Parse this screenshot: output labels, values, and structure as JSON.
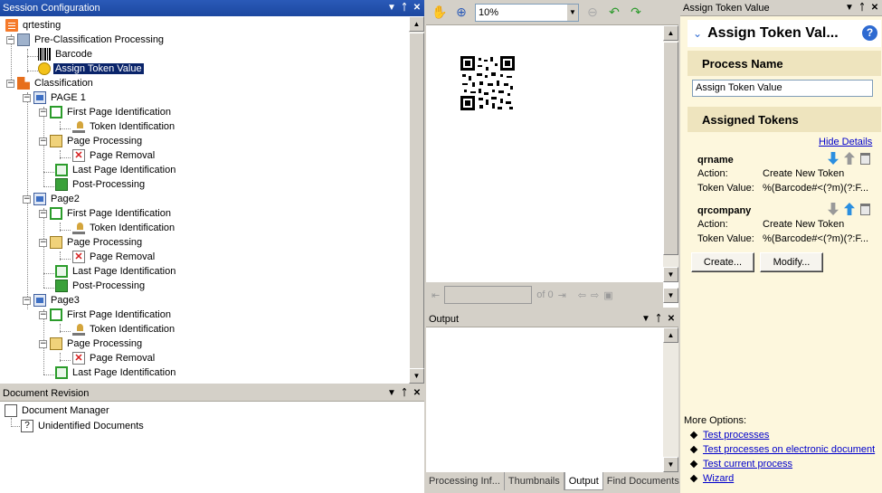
{
  "session_config": {
    "title": "Session Configuration",
    "tree": [
      {
        "label": "qrtesting",
        "icon": "doc-icon"
      },
      {
        "label": "Pre-Classification Processing",
        "icon": "gear-icon"
      },
      {
        "label": "Barcode",
        "icon": "barcode-icon"
      },
      {
        "label": "Assign Token Value",
        "icon": "token-icon"
      },
      {
        "label": "Classification",
        "icon": "classification-icon"
      },
      {
        "label": "PAGE 1",
        "icon": "page-icon"
      },
      {
        "label": "First Page Identification",
        "icon": "identification-icon"
      },
      {
        "label": "Token Identification",
        "icon": "token-identification-icon"
      },
      {
        "label": "Page Processing",
        "icon": "processing-icon"
      },
      {
        "label": "Page Removal",
        "icon": "remove-icon"
      },
      {
        "label": "Last Page Identification",
        "icon": "last-page-icon"
      },
      {
        "label": "Post-Processing",
        "icon": "post-processing-icon"
      },
      {
        "label": "Page2",
        "icon": "page-icon"
      },
      {
        "label": "First Page Identification",
        "icon": "identification-icon"
      },
      {
        "label": "Token Identification",
        "icon": "token-identification-icon"
      },
      {
        "label": "Page Processing",
        "icon": "processing-icon"
      },
      {
        "label": "Page Removal",
        "icon": "remove-icon"
      },
      {
        "label": "Last Page Identification",
        "icon": "last-page-icon"
      },
      {
        "label": "Post-Processing",
        "icon": "post-processing-icon"
      },
      {
        "label": "Page3",
        "icon": "page-icon"
      },
      {
        "label": "First Page Identification",
        "icon": "identification-icon"
      },
      {
        "label": "Token Identification",
        "icon": "token-identification-icon"
      },
      {
        "label": "Page Processing",
        "icon": "processing-icon"
      },
      {
        "label": "Page Removal",
        "icon": "remove-icon"
      },
      {
        "label": "Last Page Identification",
        "icon": "last-page-icon"
      }
    ]
  },
  "doc_revision": {
    "title": "Document Revision",
    "items": [
      {
        "label": "Document Manager",
        "icon": "document-manager-icon"
      },
      {
        "label": "Unidentified Documents",
        "icon": "unidentified-icon"
      }
    ]
  },
  "viewer": {
    "zoom": "10%",
    "page_of": "of 0"
  },
  "output": {
    "title": "Output"
  },
  "tabs": [
    "Processing Inf...",
    "Thumbnails",
    "Output",
    "Find Documents"
  ],
  "assign_panel": {
    "pane_title": "Assign Token Value",
    "heading": "Assign Token Val...",
    "process_name_label": "Process Name",
    "process_name_value": "Assign Token Value",
    "assigned_tokens_label": "Assigned Tokens",
    "hide_details": "Hide Details",
    "tokens": [
      {
        "name": "qrname",
        "action_label": "Action:",
        "action": "Create New Token",
        "value_label": "Token Value:",
        "value": "%(Barcode#<(?m)(?:F..."
      },
      {
        "name": "qrcompany",
        "action_label": "Action:",
        "action": "Create New Token",
        "value_label": "Token Value:",
        "value": "%(Barcode#<(?m)(?:F..."
      }
    ],
    "create_button": "Create...",
    "modify_button": "Modify...",
    "more_options_label": "More Options:",
    "more_options": [
      "Test processes",
      "Test processes on electronic document",
      "Test current process",
      "Wizard"
    ]
  },
  "colors": {
    "active_title": "#2a5ab8",
    "selection": "#0a246a",
    "panel_bg": "#fdf7dd",
    "section_bg": "#eee4be",
    "link": "#0000cc"
  }
}
